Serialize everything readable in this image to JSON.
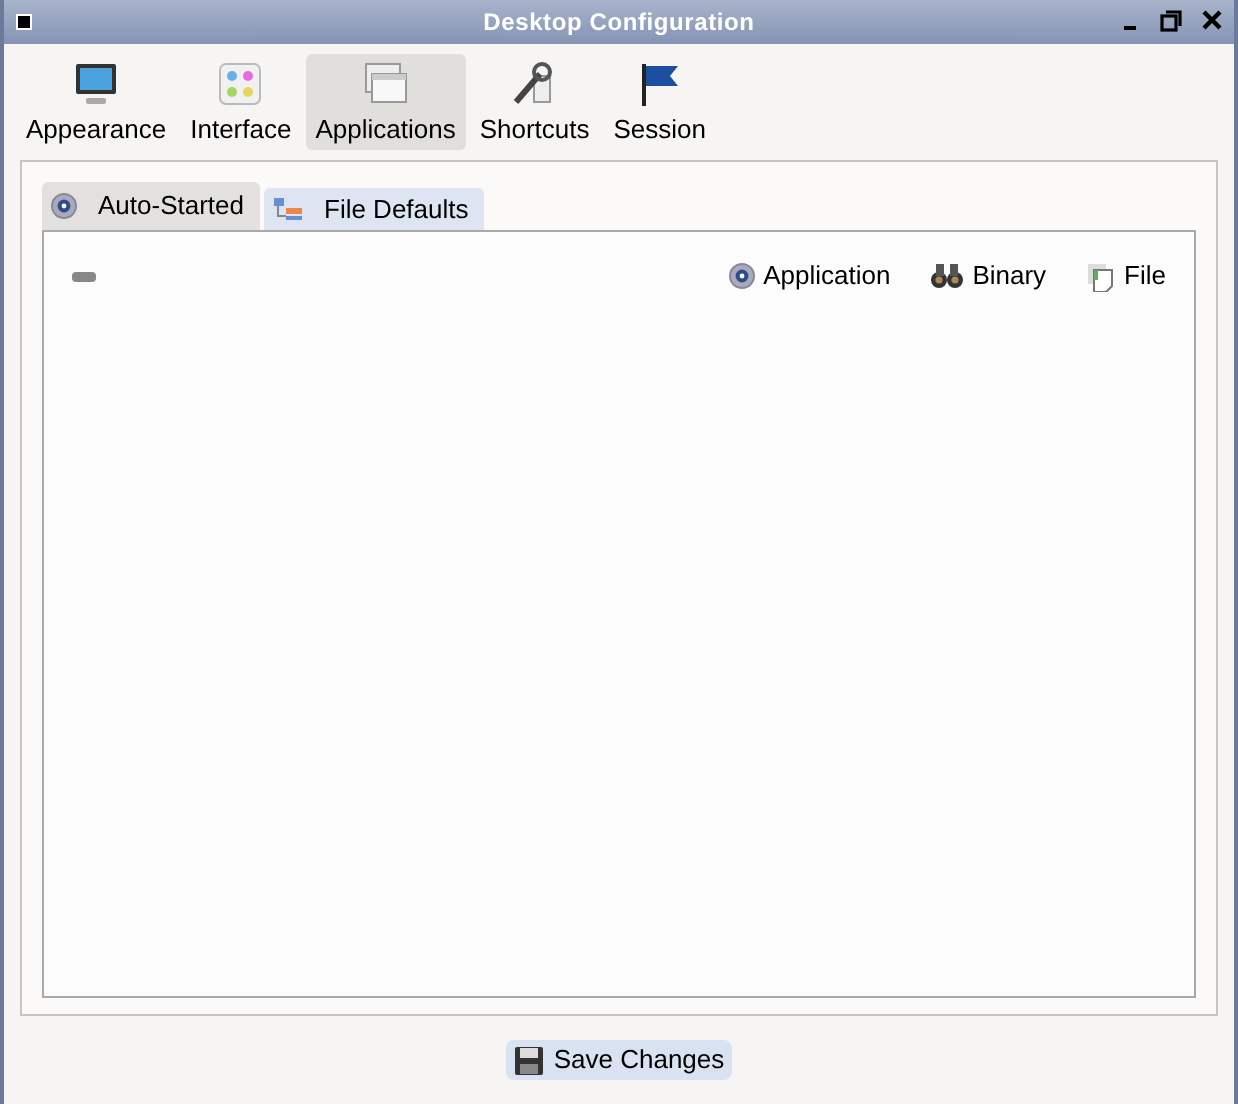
{
  "window": {
    "title": "Desktop Configuration"
  },
  "categories": [
    {
      "label": "Appearance",
      "selected": false
    },
    {
      "label": "Interface",
      "selected": false
    },
    {
      "label": "Applications",
      "selected": true
    },
    {
      "label": "Shortcuts",
      "selected": false
    },
    {
      "label": "Session",
      "selected": false
    }
  ],
  "tabs": [
    {
      "label": "Auto-Started",
      "selected": true
    },
    {
      "label": "File Defaults",
      "selected": false
    }
  ],
  "toolbar": {
    "actions": [
      {
        "label": "Application"
      },
      {
        "label": "Binary"
      },
      {
        "label": "File"
      }
    ]
  },
  "save_button": {
    "label": "Save Changes"
  }
}
